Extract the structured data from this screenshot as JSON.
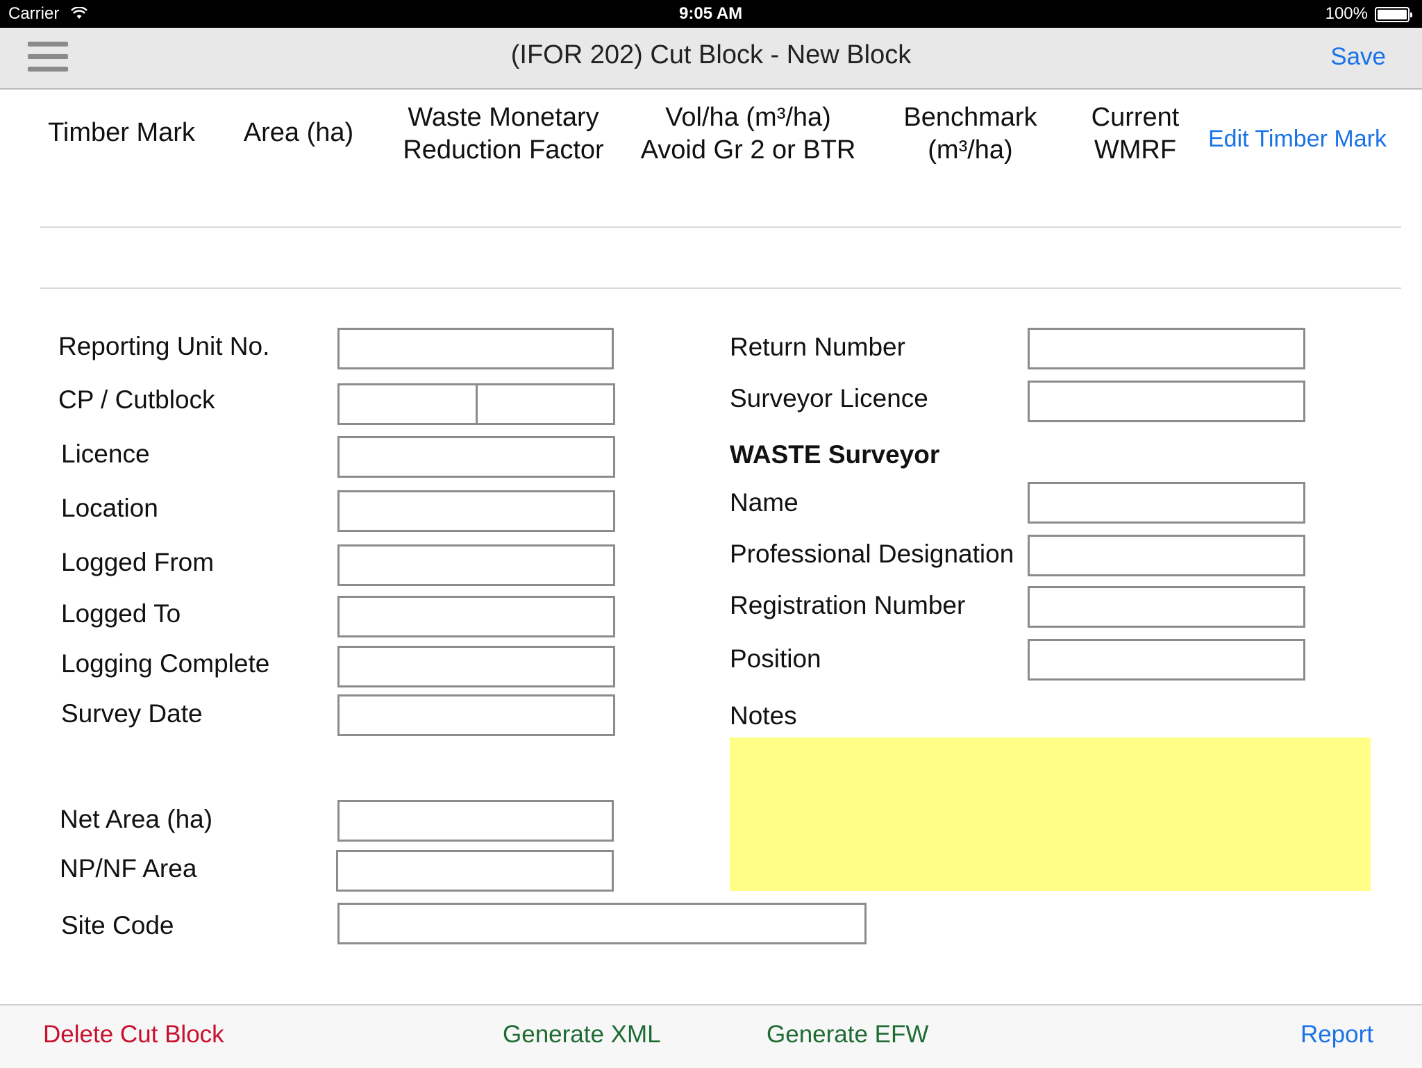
{
  "status_bar": {
    "carrier": "Carrier",
    "time": "9:05 AM",
    "battery": "100%"
  },
  "nav": {
    "title": "(IFOR 202) Cut Block - New Block",
    "save_label": "Save"
  },
  "header_columns": {
    "timber_mark": "Timber Mark",
    "area": "Area (ha)",
    "waste_line1": "Waste Monetary",
    "waste_line2": "Reduction Factor",
    "vol_line1": "Vol/ha (m³/ha)",
    "vol_line2": "Avoid Gr 2 or BTR",
    "bench_line1": "Benchmark",
    "bench_line2": "(m³/ha)",
    "current_line1": "Current",
    "current_line2": "WMRF",
    "edit_label": "Edit Timber Mark"
  },
  "left_form": {
    "reporting_unit": {
      "label": "Reporting Unit No.",
      "value": ""
    },
    "cp_cutblock": {
      "label": "CP / Cutblock",
      "cp_value": "",
      "cutblock_value": ""
    },
    "licence": {
      "label": "Licence",
      "value": ""
    },
    "location": {
      "label": "Location",
      "value": ""
    },
    "logged_from": {
      "label": "Logged From",
      "value": ""
    },
    "logged_to": {
      "label": "Logged To",
      "value": ""
    },
    "logging_complete": {
      "label": "Logging Complete",
      "value": ""
    },
    "survey_date": {
      "label": "Survey Date",
      "value": ""
    },
    "net_area": {
      "label": "Net Area (ha)",
      "value": ""
    },
    "npnf_area": {
      "label": "NP/NF Area",
      "value": ""
    },
    "site_code": {
      "label": "Site Code",
      "value": ""
    }
  },
  "right_form": {
    "return_number": {
      "label": "Return Number",
      "value": ""
    },
    "surveyor_licence": {
      "label": "Surveyor Licence",
      "value": ""
    },
    "section_title": "WASTE Surveyor",
    "name": {
      "label": "Name",
      "value": ""
    },
    "professional_designation": {
      "label": "Professional Designation",
      "value": ""
    },
    "registration_number": {
      "label": "Registration Number",
      "value": ""
    },
    "position": {
      "label": "Position",
      "value": ""
    },
    "notes": {
      "label": "Notes",
      "value": ""
    }
  },
  "bottom_bar": {
    "delete_label": "Delete Cut Block",
    "xml_label": "Generate XML",
    "efw_label": "Generate EFW",
    "report_label": "Report"
  },
  "colors": {
    "link_blue": "#1a73e8",
    "delete_red": "#c8102e",
    "generate_green": "#1e6b34",
    "notes_yellow": "#ffff88"
  },
  "icons": {
    "menu": "hamburger-menu-icon",
    "wifi": "wifi-icon",
    "battery": "battery-icon"
  }
}
